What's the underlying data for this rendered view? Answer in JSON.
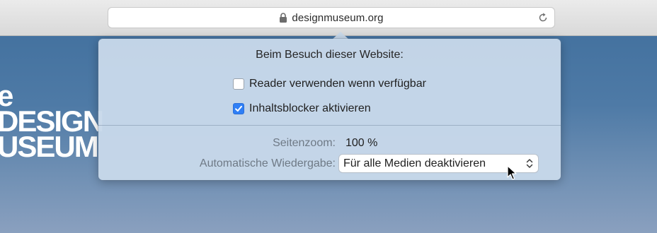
{
  "browser": {
    "url": "designmuseum.org"
  },
  "background": {
    "logo_lines": [
      "e",
      "DESIGN",
      "USEUM"
    ]
  },
  "popover": {
    "title": "Beim Besuch dieser Website:",
    "options": [
      {
        "label": "Reader verwenden wenn verfügbar",
        "checked": false
      },
      {
        "label": "Inhaltsblocker aktivieren",
        "checked": true
      }
    ],
    "zoom_label": "Seitenzoom:",
    "zoom_value": "100 %",
    "autoplay_label": "Automatische Wiedergabe:",
    "autoplay_value": "Für alle Medien deaktivieren"
  },
  "colors": {
    "accent": "#2f7ff6"
  },
  "icons": {
    "address_lock": "lock-icon",
    "address_reload": "reload-icon",
    "select": "chevron-updown-icon",
    "cursor": "mouse-pointer-icon"
  }
}
